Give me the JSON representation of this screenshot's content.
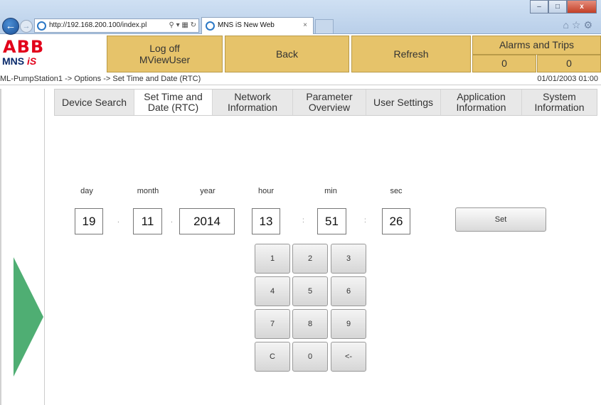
{
  "browser": {
    "url": "http://192.168.200.100/index.pl",
    "tab_title": "MNS iS New Web",
    "tab_close": "×",
    "window_min": "–",
    "window_max": "□",
    "window_close": "x"
  },
  "logo": {
    "brand": "ABB",
    "product": "MNS",
    "product_suffix": "iS"
  },
  "header": {
    "logoff_line1": "Log off",
    "logoff_line2": "MViewUser",
    "back": "Back",
    "refresh": "Refresh",
    "alarms_title": "Alarms and Trips",
    "alarms_count": "0",
    "trips_count": "0"
  },
  "breadcrumb": "ML-PumpStation1 -> Options -> Set Time and Date (RTC)",
  "device_datetime": "01/01/2003 01:00",
  "tabs": [
    {
      "line1": "Device Search",
      "line2": ""
    },
    {
      "line1": "Set Time and",
      "line2": "Date (RTC)"
    },
    {
      "line1": "Network",
      "line2": "Information"
    },
    {
      "line1": "Parameter",
      "line2": "Overview"
    },
    {
      "line1": "User Settings",
      "line2": ""
    },
    {
      "line1": "Application",
      "line2": "Information"
    },
    {
      "line1": "System",
      "line2": "Information"
    }
  ],
  "rtc": {
    "labels": {
      "day": "day",
      "month": "month",
      "year": "year",
      "hour": "hour",
      "min": "min",
      "sec": "sec"
    },
    "values": {
      "day": "19",
      "month": "11",
      "year": "2014",
      "hour": "13",
      "min": "51",
      "sec": "26"
    },
    "date_sep": ".",
    "time_sep": ":",
    "set_label": "Set"
  },
  "keypad": [
    "1",
    "2",
    "3",
    "4",
    "5",
    "6",
    "7",
    "8",
    "9",
    "C",
    "0",
    "<-"
  ],
  "colors": {
    "header_button": "#e6c36a",
    "nav_arrow": "#4fae73",
    "abb_red": "#e2001a"
  }
}
